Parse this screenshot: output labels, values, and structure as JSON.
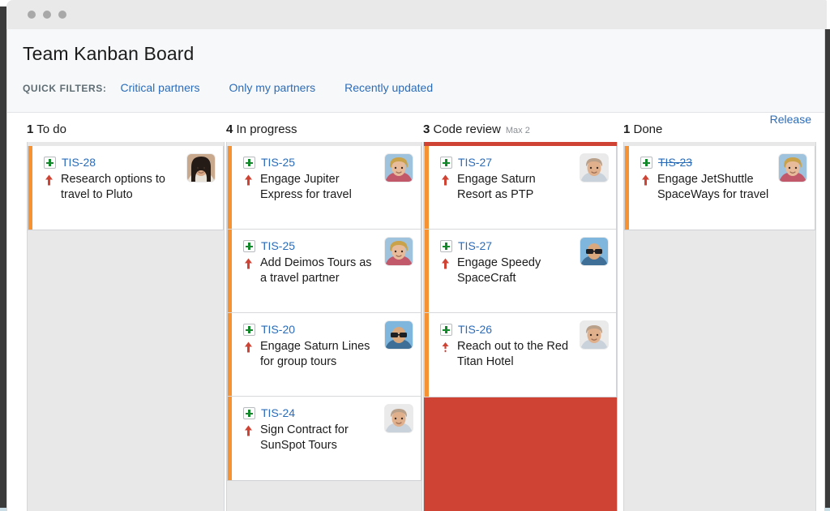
{
  "window": {
    "dots": [
      "dot-1",
      "dot-2",
      "dot-3"
    ]
  },
  "header": {
    "title": "Team Kanban Board",
    "filters_label": "QUICK FILTERS:",
    "filters": [
      {
        "label": "Critical partners"
      },
      {
        "label": "Only my partners"
      },
      {
        "label": "Recently updated"
      }
    ]
  },
  "board": {
    "release_label": "Release",
    "accent_blue": "#2b6cb9",
    "card_stripe_color": "#f79232",
    "over_limit_color": "#cf4335",
    "columns": [
      {
        "id": "to-do",
        "count": "1",
        "name": "To do",
        "max": "",
        "over_limit": false,
        "cards": [
          {
            "key": "TIS-28",
            "summary": "Research options to travel to Pluto",
            "type_icon": "story-plus-icon",
            "priority_icon": "priority-major-up-arrow-icon",
            "avatar": "avatar-woman-dark-hair",
            "done": false
          }
        ]
      },
      {
        "id": "in-progress",
        "count": "4",
        "name": "In progress",
        "max": "",
        "over_limit": false,
        "cards": [
          {
            "key": "TIS-25",
            "summary": "Engage Jupiter Express for travel",
            "type_icon": "story-plus-icon",
            "priority_icon": "priority-major-up-arrow-icon",
            "avatar": "avatar-woman-blonde",
            "done": false
          },
          {
            "key": "TIS-25",
            "summary": "Add Deimos Tours as a travel partner",
            "type_icon": "story-plus-icon",
            "priority_icon": "priority-major-up-arrow-icon",
            "avatar": "avatar-woman-blonde",
            "done": false
          },
          {
            "key": "TIS-20",
            "summary": "Engage Saturn Lines for group tours",
            "type_icon": "story-plus-icon",
            "priority_icon": "priority-major-up-arrow-icon",
            "avatar": "avatar-man-sunglasses",
            "done": false
          },
          {
            "key": "TIS-24",
            "summary": "Sign Contract for SunSpot Tours",
            "type_icon": "story-plus-icon",
            "priority_icon": "priority-major-up-arrow-icon",
            "avatar": "avatar-man-smiling",
            "done": false
          }
        ]
      },
      {
        "id": "code-review",
        "count": "3",
        "name": "Code review",
        "max": "Max 2",
        "over_limit": true,
        "cards": [
          {
            "key": "TIS-27",
            "summary": "Engage Saturn Resort as PTP",
            "type_icon": "story-plus-icon",
            "priority_icon": "priority-major-up-arrow-icon",
            "avatar": "avatar-man-smiling",
            "done": false
          },
          {
            "key": "TIS-27",
            "summary": "Engage Speedy SpaceCraft",
            "type_icon": "story-plus-icon",
            "priority_icon": "priority-major-up-arrow-icon",
            "avatar": "avatar-man-sunglasses",
            "done": false
          },
          {
            "key": "TIS-26",
            "summary": "Reach out to the Red Titan Hotel",
            "type_icon": "story-plus-icon",
            "priority_icon": "priority-minor-up-arrow-icon",
            "avatar": "avatar-man-smiling",
            "done": false
          }
        ]
      },
      {
        "id": "done",
        "count": "1",
        "name": "Done",
        "max": "",
        "over_limit": false,
        "cards": [
          {
            "key": "TIS-23",
            "summary": "Engage JetShuttle SpaceWays for travel",
            "type_icon": "story-plus-icon",
            "priority_icon": "priority-major-up-arrow-icon",
            "avatar": "avatar-woman-blonde",
            "done": true
          }
        ]
      }
    ]
  }
}
